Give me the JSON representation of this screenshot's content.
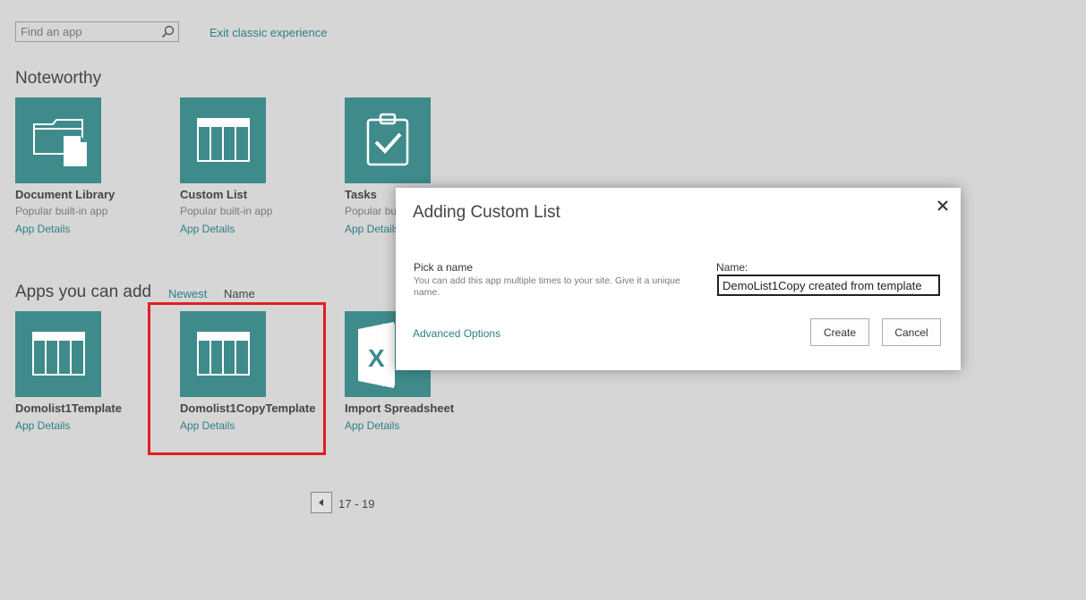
{
  "search": {
    "placeholder": "Find an app",
    "value": ""
  },
  "header": {
    "exit_link": "Exit classic experience"
  },
  "noteworthy": {
    "title": "Noteworthy",
    "apps": [
      {
        "name": "Document Library",
        "desc": "Popular built-in app",
        "link": "App Details",
        "icon": "document-library-icon"
      },
      {
        "name": "Custom List",
        "desc": "Popular built-in app",
        "link": "App Details",
        "icon": "custom-list-icon"
      },
      {
        "name": "Tasks",
        "desc": "Popular bu",
        "link": "App Details",
        "icon": "tasks-icon"
      }
    ]
  },
  "apps_you_can_add": {
    "title": "Apps you can add",
    "sort": {
      "newest": "Newest",
      "name": "Name"
    },
    "apps": [
      {
        "name": "Domolist1Template",
        "link": "App Details",
        "icon": "custom-list-icon"
      },
      {
        "name": "Domolist1CopyTemplate",
        "link": "App Details",
        "icon": "custom-list-icon"
      },
      {
        "name": "Import Spreadsheet",
        "link": "App Details",
        "icon": "excel-icon"
      }
    ]
  },
  "pager": {
    "range": "17 - 19"
  },
  "dialog": {
    "title": "Adding Custom List",
    "pick_label": "Pick a name",
    "pick_help": "You can add this app multiple times to your site. Give it a unique name.",
    "name_label": "Name:",
    "name_value": "DemoList1Copy created from template",
    "advanced_link": "Advanced Options",
    "create_label": "Create",
    "cancel_label": "Cancel"
  },
  "colors": {
    "tile": "#3f8b8b",
    "link": "#2d7f85",
    "highlight": "#e31e24",
    "background": "#d6d6d6"
  }
}
